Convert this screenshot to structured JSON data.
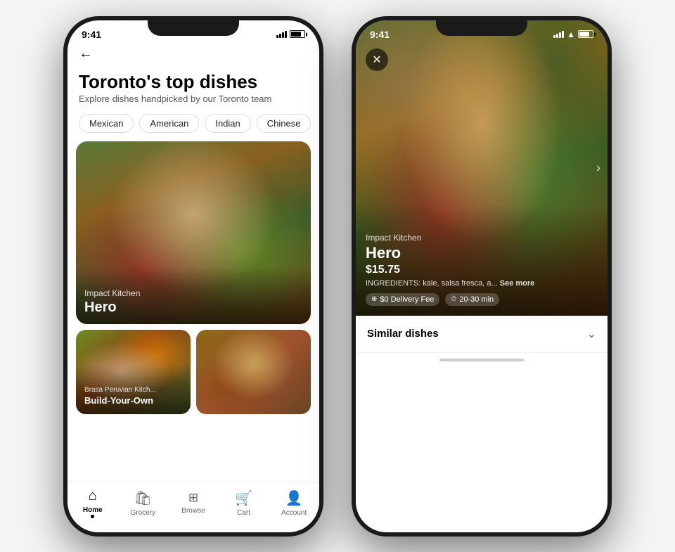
{
  "left_phone": {
    "status": {
      "time": "9:41",
      "signal": true,
      "wifi": false,
      "battery": 80
    },
    "back_label": "←",
    "title": "Toronto's top dishes",
    "subtitle": "Explore dishes handpicked by our Toronto team",
    "filters": [
      {
        "label": "Mexican",
        "active": false
      },
      {
        "label": "American",
        "active": false
      },
      {
        "label": "Indian",
        "active": false
      },
      {
        "label": "Chinese",
        "active": false
      }
    ],
    "hero_card": {
      "restaurant": "Impact Kitchen",
      "dish": "Hero"
    },
    "small_cards": [
      {
        "restaurant": "Brasa Peruvian Kitch...",
        "dish": "Build-Your-Own"
      },
      {
        "restaurant": "",
        "dish": ""
      }
    ],
    "nav": [
      {
        "label": "Home",
        "active": true,
        "icon": "⌂"
      },
      {
        "label": "Grocery",
        "active": false,
        "icon": "🛍"
      },
      {
        "label": "Browse",
        "active": false,
        "icon": "🔍"
      },
      {
        "label": "Cart",
        "active": false,
        "icon": "🛒"
      },
      {
        "label": "Account",
        "active": false,
        "icon": "👤"
      }
    ]
  },
  "right_phone": {
    "status": {
      "time": "9:41",
      "signal": true,
      "wifi": true,
      "battery": 80
    },
    "close_label": "✕",
    "restaurant": "Impact Kitchen",
    "dish": "Hero",
    "price": "$15.75",
    "ingredients": "INGREDIENTS: kale, salsa fresca, a...",
    "see_more": "See more",
    "delivery_fee": "$0 Delivery Fee",
    "delivery_time": "20-30 min",
    "similar_dishes": "Similar dishes",
    "chevron": "⌄"
  }
}
